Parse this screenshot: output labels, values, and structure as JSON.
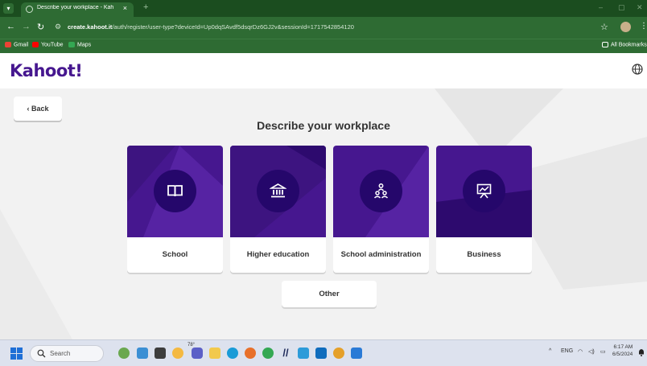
{
  "browser": {
    "tab_title": "Describe your workplace - Kah",
    "tab_close": "×",
    "new_tab": "+",
    "minimize": "–",
    "maximize": "▢",
    "close": "✕",
    "url_domain": "create.kahoot.it",
    "url_path": "/auth/register/user-type?deviceId=Up0dqSAvdf5dsqrDz6GJ2v&sessionId=1717542854120",
    "bookmarks": [
      {
        "label": "Gmail",
        "icon": "gmail-icon",
        "color": "#ea4335"
      },
      {
        "label": "YouTube",
        "icon": "youtube-icon",
        "color": "#ff0000"
      },
      {
        "label": "Maps",
        "icon": "maps-icon",
        "color": "#34a853"
      }
    ],
    "all_bookmarks": "All Bookmarks"
  },
  "header": {
    "logo": "Kahoot!",
    "language_icon": "globe-icon"
  },
  "page": {
    "back_label": "Back",
    "heading": "Describe your workplace",
    "options": [
      {
        "label": "School",
        "icon": "book-icon"
      },
      {
        "label": "Higher education",
        "icon": "institution-icon"
      },
      {
        "label": "School administration",
        "icon": "people-icon"
      },
      {
        "label": "Business",
        "icon": "presentation-icon"
      }
    ],
    "other_label": "Other"
  },
  "taskbar": {
    "search_placeholder": "Search",
    "weather": "78°",
    "language": "ENG",
    "time": "6:17 AM",
    "date": "6/5/2024"
  },
  "colors": {
    "brand_purple": "#46178f",
    "dark_purple": "#25076b",
    "browser_green": "#2e6b33"
  }
}
